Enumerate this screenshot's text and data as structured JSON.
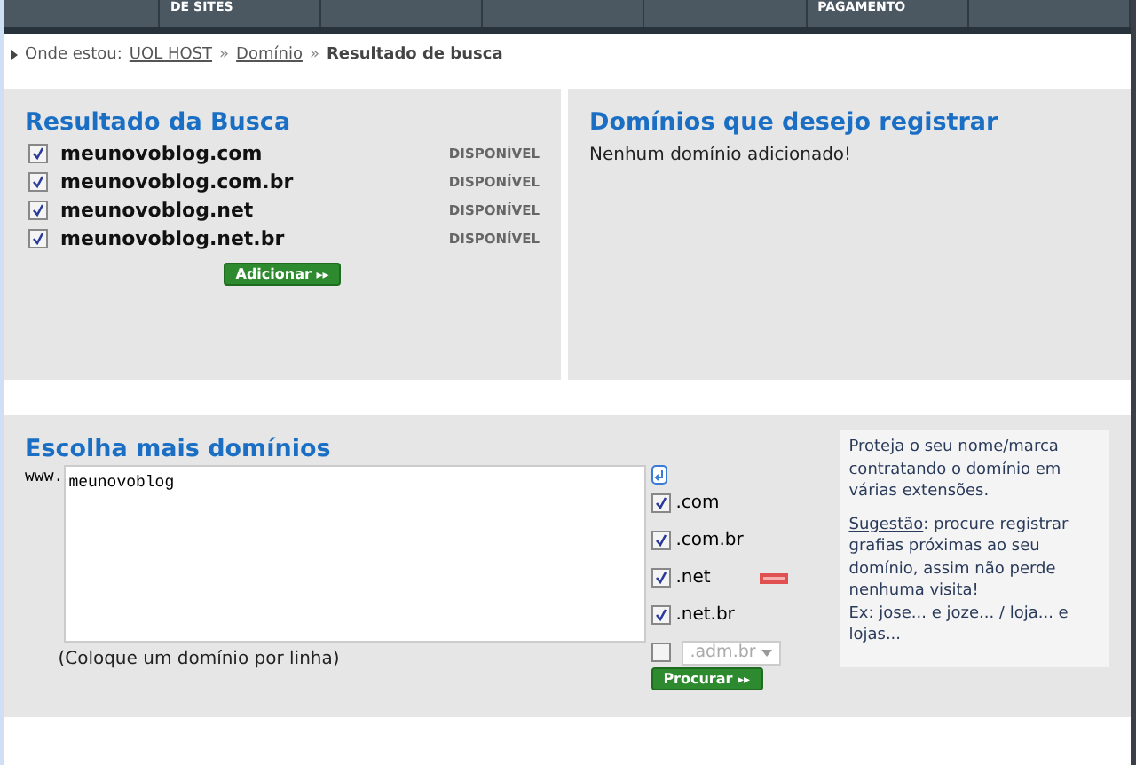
{
  "nav_tabs": [
    {
      "kind": "blank"
    },
    {
      "kind": "text",
      "label": "DE SITES"
    },
    {
      "kind": "blank"
    },
    {
      "kind": "blank"
    },
    {
      "kind": "blank"
    },
    {
      "kind": "text",
      "label": "PAGAMENTO"
    },
    {
      "kind": "blank"
    }
  ],
  "breadcrumb": {
    "prefix": "Onde estou:",
    "links": [
      "UOL HOST",
      "Domínio"
    ],
    "separator": "»",
    "current": "Resultado de busca"
  },
  "results": {
    "title": "Resultado da Busca",
    "items": [
      {
        "domain": "meunovoblog.com",
        "checked": true,
        "status": "DISPONÍVEL"
      },
      {
        "domain": "meunovoblog.com.br",
        "checked": true,
        "status": "DISPONÍVEL"
      },
      {
        "domain": "meunovoblog.net",
        "checked": true,
        "status": "DISPONÍVEL"
      },
      {
        "domain": "meunovoblog.net.br",
        "checked": true,
        "status": "DISPONÍVEL"
      }
    ],
    "button": "Adicionar",
    "button_icon": "▸▸"
  },
  "register": {
    "title": "Domínios que desejo registrar",
    "message": "Nenhum domínio adicionado!"
  },
  "more": {
    "title": "Escolha mais domínios",
    "prefix": "www.",
    "value": "meunovoblog",
    "hint": "(Coloque um domínio por linha)",
    "extensions": [
      {
        "kind": "checkbox",
        "label": ".com",
        "checked": true,
        "badge": false
      },
      {
        "kind": "checkbox",
        "label": ".com.br",
        "checked": true,
        "badge": false
      },
      {
        "kind": "checkbox",
        "label": ".net",
        "checked": true,
        "badge": true
      },
      {
        "kind": "checkbox",
        "label": ".net.br",
        "checked": true,
        "badge": false
      },
      {
        "kind": "select",
        "value": ".adm.br",
        "checked": false
      }
    ],
    "button": "Procurar",
    "button_icon": "▸▸"
  },
  "tip": {
    "text": "Proteja o seu nome/marca contratando o domínio em várias extensões.",
    "link": "Sugestão",
    "rest": ": procure registrar grafias próximas ao seu domínio, assim não perde nenhuma visita!",
    "example": "Ex: jose... e joze... / loja... e lojas..."
  }
}
